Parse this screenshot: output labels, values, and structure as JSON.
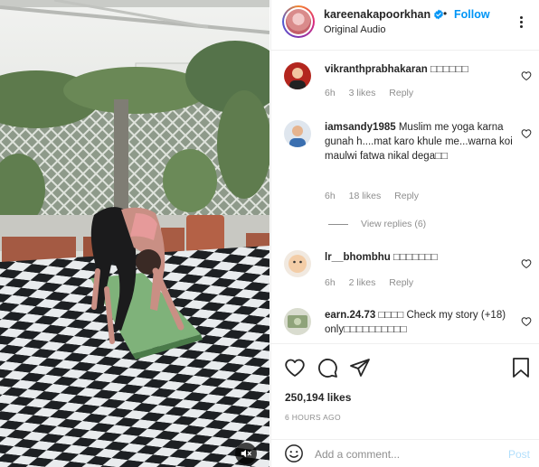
{
  "post": {
    "username": "kareenakapoorkhan",
    "dot": "•",
    "follow_label": "Follow",
    "audio": "Original Audio"
  },
  "comments": [
    {
      "username": "vikranthprabhakaran",
      "text": "□□□□□□",
      "time": "6h",
      "likes": "3 likes",
      "reply_label": "Reply"
    },
    {
      "username": "iamsandy1985",
      "text": "Muslim me yoga karna gunah h....mat karo khule me...warna koi maulwi fatwa nikal dega□□",
      "time": "6h",
      "likes": "18 likes",
      "reply_label": "Reply",
      "view_replies": "View replies (6)"
    },
    {
      "username": "lr__bhombhu",
      "text": "□□□□□□□",
      "time": "6h",
      "likes": "2 likes",
      "reply_label": "Reply"
    },
    {
      "username": "earn.24.73",
      "text": "□□□□ Check my story (+18) only□□□□□□□□□□",
      "time": "",
      "likes": "",
      "reply_label": ""
    }
  ],
  "actions": {
    "likes": "250,194 likes",
    "time_ago": "6 HOURS AGO"
  },
  "add_comment": {
    "placeholder": "Add a comment...",
    "post_label": "Post"
  },
  "colors": {
    "link_blue": "#0095f6",
    "post_disabled": "#b2dffc",
    "muted": "#8e8e8e",
    "text": "#262626"
  },
  "icons": [
    "verified-badge-icon",
    "more-options-icon",
    "heart-icon",
    "comment-icon",
    "share-icon",
    "bookmark-icon",
    "emoji-icon",
    "volume-muted-icon"
  ]
}
